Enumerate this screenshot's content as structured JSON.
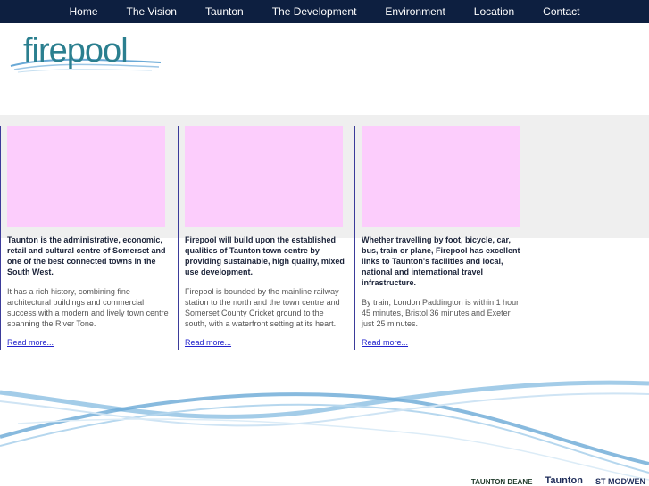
{
  "nav": {
    "items": [
      "Home",
      "The Vision",
      "Taunton",
      "The Development",
      "Environment",
      "Location",
      "Contact"
    ]
  },
  "logo": {
    "text": "firepool"
  },
  "columns": [
    {
      "lead": "Taunton is the administrative, economic, retail and cultural centre of Somerset and one of the best connected towns in the South West.",
      "body": "It has a rich history, combining fine architectural buildings and commercial success with a modern and lively town centre spanning the River Tone.",
      "more": "Read more..."
    },
    {
      "lead": "Firepool will build upon the established qualities of Taunton town centre by providing sustainable, high quality, mixed use development.",
      "body": "Firepool is bounded by the mainline railway station to the north and the town centre and Somerset County Cricket ground to the south, with a waterfront setting at its heart.",
      "more": "Read more..."
    },
    {
      "lead": "Whether travelling by foot, bicycle, car, bus, train or plane, Firepool has excellent links to Taunton's facilities and local, national and international travel infrastructure.",
      "body": "By train, London Paddington is within 1 hour 45 minutes, Bristol 36 minutes and Exeter just 25 minutes.",
      "more": "Read more..."
    }
  ],
  "partners": {
    "p1": "TAUNTON DEANE",
    "p2": "Taunton",
    "p3": "ST MODWEN"
  },
  "colors": {
    "nav_bg": "#0d1f40",
    "band_bg": "#efefef",
    "photo_placeholder": "#fccdfc",
    "wave": "#6aa9d6"
  }
}
